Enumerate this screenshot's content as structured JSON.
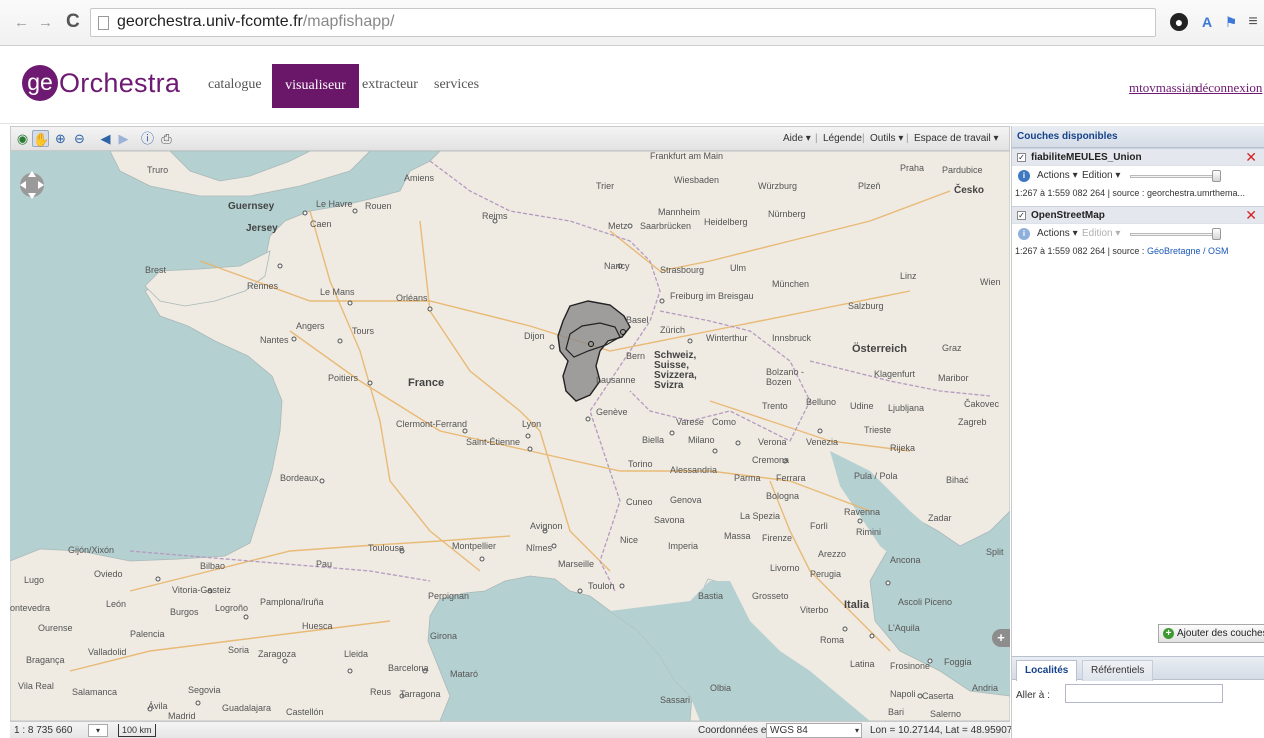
{
  "browser": {
    "url_host": "georchestra.univ-fcomte.fr",
    "url_path": "/mapfishapp/",
    "back_icon": "arrow-left-icon",
    "forward_icon": "arrow-right-icon",
    "reload_icon": "reload-icon"
  },
  "header": {
    "logo_ge": "ge",
    "logo_text": "Orchestra",
    "nav": {
      "catalogue": "catalogue",
      "visualiseur": "visualiseur",
      "extracteur": "extracteur",
      "services": "services"
    },
    "user": "mtovmassian",
    "separator": "|",
    "logout": "déconnexion",
    "brand_color": "#6e1a72"
  },
  "toolbar": {
    "tools": [
      "globe-icon",
      "pan-hand-icon",
      "zoom-in-icon",
      "zoom-out-icon",
      "previous-icon",
      "next-icon",
      "info-icon",
      "print-icon"
    ],
    "aide": "Aide ▾",
    "legende": "Légende",
    "outils": "Outils ▾",
    "espace": "Espace de travail ▾",
    "sep": "|"
  },
  "map": {
    "labels": {
      "truro": "Truro",
      "guernsey": "Guernsey",
      "jersey": "Jersey",
      "le_havre": "Le Havre",
      "rouen": "Rouen",
      "caen": "Caen",
      "amiens": "Amiens",
      "reims": "Reims",
      "brest": "Brest",
      "rennes": "Rennes",
      "le_mans": "Le Mans",
      "orleans": "Orléans",
      "angers": "Angers",
      "tours": "Tours",
      "nantes": "Nantes",
      "poitiers": "Poitiers",
      "france": "France",
      "dijon": "Dijon",
      "clermont": "Clermont-Ferrand",
      "lyon": "Lyon",
      "saint_etienne": "Saint-Étienne",
      "bordeaux": "Bordeaux",
      "toulouse": "Toulouse",
      "montpellier": "Montpellier",
      "nimes": "Nîmes",
      "avignon": "Avignon",
      "marseille": "Marseille",
      "toulon": "Toulon",
      "nice": "Nice",
      "pau": "Pau",
      "perpignan": "Perpignan",
      "bilbao": "Bilbao",
      "gijon": "Gijón/Xixón",
      "oviedo": "Oviedo",
      "lugo": "Lugo",
      "vitoria": "Vitoria-Gasteiz",
      "leon": "León",
      "burgos": "Burgos",
      "logrono": "Logroño",
      "pamplona": "Pamplona/Iruña",
      "pontevedra": "ontevedra",
      "ourense": "Ourense",
      "palencia": "Palencia",
      "huesca": "Huesca",
      "girona": "Girona",
      "braganca": "Bragança",
      "valladolid": "Valladolid",
      "soria": "Soria",
      "zaragoza": "Zaragoza",
      "lleida": "Lleida",
      "barcelona": "Barcelona",
      "mataro": "Mataró",
      "vila_real": "Vila Real",
      "salamanca": "Salamanca",
      "segovia": "Segovia",
      "avila": "Ávila",
      "madrid": "Madrid",
      "guadalajara": "Guadalajara",
      "reus": "Reus",
      "tarragona": "Tarragona",
      "castellon": "Castellón",
      "frankfurt": "Frankfurt am Main",
      "wiesbaden": "Wiesbaden",
      "trier": "Trier",
      "wurzburg": "Würzburg",
      "mannheim": "Mannheim",
      "heidelberg": "Heidelberg",
      "nurnberg": "Nürnberg",
      "metz": "Metz",
      "saarbrucken": "Saarbrücken",
      "nancy": "Nancy",
      "strasbourg": "Strasbourg",
      "ulm": "Ulm",
      "munchen": "München",
      "freiburg": "Freiburg im Breisgau",
      "basel": "Basel",
      "zurich": "Zürich",
      "winterthur": "Winterthur",
      "innsbruck": "Innsbruck",
      "bern": "Bern",
      "schweiz": "Schweiz, Suisse, Svizzera, Svizra",
      "lausanne": "Lausanne",
      "geneve": "Genève",
      "bolzano": "Bolzano - Bozen",
      "osterreich": "Österreich",
      "graz": "Graz",
      "klagenfurt": "Klagenfurt",
      "maribor": "Maribor",
      "salzburg": "Salzburg",
      "linz": "Linz",
      "wien": "Wien",
      "praha": "Praha",
      "pardubice": "Pardubice",
      "plzen": "Plzeň",
      "cesko": "Česko",
      "trento": "Trento",
      "belluno": "Belluno",
      "udine": "Udine",
      "ljubljana": "Ljubljana",
      "cakovec": "Čakovec",
      "zagreb": "Zagreb",
      "trieste": "Trieste",
      "rijeka": "Rijeka",
      "varese": "Varese",
      "como": "Como",
      "biella": "Biella",
      "milano": "Milano",
      "verona": "Verona",
      "venezia": "Venezia",
      "torino": "Torino",
      "alessandria": "Alessandria",
      "cremona": "Cremona",
      "parma": "Parma",
      "ferrara": "Ferrara",
      "bologna": "Bologna",
      "pula": "Pula / Pola",
      "bihac": "Bihać",
      "cuneo": "Cuneo",
      "genova": "Genova",
      "savona": "Savona",
      "la_spezia": "La Spezia",
      "forli": "Forlì",
      "ravenna": "Ravenna",
      "rimini": "Rimini",
      "zadar": "Zadar",
      "split": "Split",
      "imperia": "Imperia",
      "massa": "Massa",
      "firenze": "Firenze",
      "arezzo": "Arezzo",
      "ancona": "Ancona",
      "livorno": "Livorno",
      "perugia": "Perugia",
      "bastia": "Bastia",
      "grosseto": "Grosseto",
      "viterbo": "Viterbo",
      "italia": "Italia",
      "ascoli": "Ascoli Piceno",
      "laquila": "L'Aquila",
      "roma": "Roma",
      "latina": "Latina",
      "frosinone": "Frosinone",
      "foggia": "Foggia",
      "napoli": "Napoli",
      "caserta": "Caserta",
      "andria": "Andria",
      "sassari": "Sassari",
      "olbia": "Olbia",
      "bari": "Bari",
      "salerno": "Salerno"
    }
  },
  "status": {
    "scale": "1 : 8 735 660",
    "scale_bar": "100 km",
    "coords_label": "Coordonnées en",
    "projection": "WGS 84",
    "readout": "Lon = 10.27144, Lat = 48.95907"
  },
  "panel": {
    "title": "Couches disponibles",
    "layers": [
      {
        "name": "fiabiliteMEULES_Union",
        "actions": "Actions ▾",
        "edition": "Edition ▾",
        "edition_enabled": true,
        "source_prefix": "1:267 à 1:559 082 264 | source : ",
        "source_name": "georchestra.umrthema..."
      },
      {
        "name": "OpenStreetMap",
        "actions": "Actions ▾",
        "edition": "Edition ▾",
        "edition_enabled": false,
        "source_prefix": "1:267 à 1:559 082 264 | source : ",
        "source_name": "GéoBretagne / OSM"
      }
    ],
    "add_layers": "Ajouter des couches",
    "tabs": [
      "Localités",
      "Référentiels"
    ],
    "goto_label": "Aller à :",
    "goto_value": ""
  }
}
